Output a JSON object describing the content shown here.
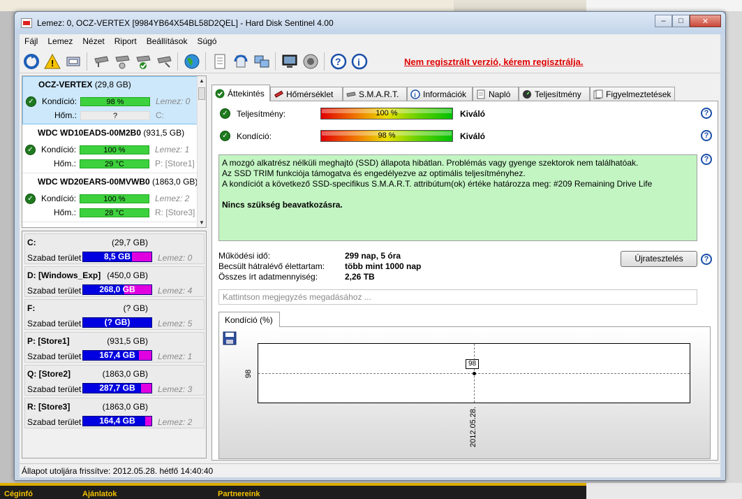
{
  "window": {
    "title": "Lemez: 0, OCZ-VERTEX [9984YB64X54BL58D2QEL]  -  Hard Disk Sentinel 4.00",
    "minimize": "–",
    "maximize": "□",
    "close": "✕"
  },
  "menu": [
    "Fájl",
    "Lemez",
    "Nézet",
    "Riport",
    "Beállítások",
    "Súgó"
  ],
  "toolbar": {
    "warning": "Nem regisztrált verzió, kérem regisztrálja."
  },
  "disks": [
    {
      "name": "OCZ-VERTEX",
      "size": "(29,8 GB)",
      "cond_label": "Kondíció:",
      "cond": "98 %",
      "temp_label": "Hőm.:",
      "temp": "?",
      "lemez": "Lemez: 0",
      "drv": "C:"
    },
    {
      "name": "WDC WD10EADS-00M2B0",
      "size": "(931,5 GB)",
      "cond_label": "Kondíció:",
      "cond": "100 %",
      "temp_label": "Hőm.:",
      "temp": "29 °C",
      "lemez": "Lemez: 1",
      "drv": "P: [Store1]"
    },
    {
      "name": "WDC WD20EARS-00MVWB0",
      "size": "(1863,0 GB)",
      "cond_label": "Kondíció:",
      "cond": "100 %",
      "temp_label": "Hőm.:",
      "temp": "28 °C",
      "lemez": "Lemez: 2",
      "drv": "R: [Store3]"
    }
  ],
  "volumes": [
    {
      "label": "C:",
      "size": "(29,7 GB)",
      "free_label": "Szabad terület",
      "free": "8,5 GB",
      "used_fraction": 0.29,
      "lemez": "Lemez: 0"
    },
    {
      "label": "D: [Windows_Exp]",
      "size": "(450,0 GB)",
      "free_label": "Szabad terület",
      "free": "268,0 GB",
      "used_fraction": 0.4,
      "lemez": "Lemez: 4"
    },
    {
      "label": "F:",
      "size": "(? GB)",
      "free_label": "Szabad terület",
      "free": "(? GB)",
      "used_fraction": 0.0,
      "lemez": "Lemez: 5"
    },
    {
      "label": "P: [Store1]",
      "size": "(931,5 GB)",
      "free_label": "Szabad terület",
      "free": "167,4 GB",
      "used_fraction": 0.18,
      "lemez": "Lemez: 1"
    },
    {
      "label": "Q: [Store2]",
      "size": "(1863,0 GB)",
      "free_label": "Szabad terület",
      "free": "287,7 GB",
      "used_fraction": 0.15,
      "lemez": "Lemez: 3"
    },
    {
      "label": "R: [Store3]",
      "size": "(1863,0 GB)",
      "free_label": "Szabad terület",
      "free": "164,4 GB",
      "used_fraction": 0.09,
      "lemez": "Lemez: 2"
    }
  ],
  "tabs": [
    "Áttekintés",
    "Hőmérséklet",
    "S.M.A.R.T.",
    "Információk",
    "Napló",
    "Teljesítmény",
    "Figyelmeztetések"
  ],
  "overview": {
    "perf_label": "Teljesítmény:",
    "perf_value": "100 %",
    "perf_fraction": 1.0,
    "perf_rating": "Kiváló",
    "cond_label": "Kondíció:",
    "cond_value": "98 %",
    "cond_fraction": 0.98,
    "cond_rating": "Kiváló",
    "info_lines": [
      "A mozgó alkatrész nélküli meghajtó (SSD) állapota hibátlan. Problémás vagy gyenge szektorok nem találhatóak.",
      "Az SSD TRIM funkciója támogatva és engedélyezve az optimális teljesítményhez.",
      "A kondíciót a következő SSD-specifikus S.M.A.R.T. attribútum(ok) értéke határozza meg:  #209 Remaining Drive Life"
    ],
    "info_conclusion": "Nincs szükség beavatkozásra.",
    "stats": [
      {
        "k": "Működési idő:",
        "v": "299 nap, 5 óra"
      },
      {
        "k": "Becsült hátralévő élettartam:",
        "v": "több mint 1000 nap"
      },
      {
        "k": "Összes írt adatmennyiség:",
        "v": "2,26 TB"
      }
    ],
    "retest_button": "Újratesztelés",
    "note_placeholder": "Kattintson megjegyzés megadásához ..."
  },
  "chart_tab": "Kondíció  (%)",
  "chart_data": {
    "type": "line",
    "series": [
      {
        "x": [
          "2012.05.28."
        ],
        "values": [
          98
        ]
      }
    ],
    "x": [
      "2012.05.28."
    ],
    "ytick": "98",
    "point_label": "98"
  },
  "status": "Állapot utoljára frissítve: 2012.05.28. hétfő 14:40:40",
  "taskbar": [
    "Céginfó",
    "Ajánlatok",
    "Partnereink"
  ]
}
